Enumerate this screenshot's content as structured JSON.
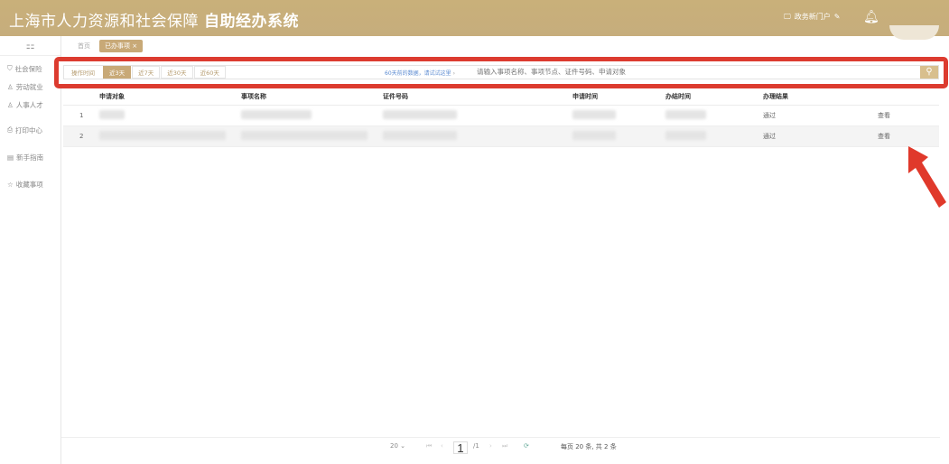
{
  "header": {
    "title": "上海市人力资源和社会保障",
    "subtitle": "自助经办系统",
    "portal_label": "政务新门户",
    "portal_icon": "monitor-icon",
    "bell_icon": "bell-icon"
  },
  "sidebar": {
    "items": [
      {
        "label": "社会保险",
        "icon": "shield-icon"
      },
      {
        "label": "劳动就业",
        "icon": "person-icon"
      },
      {
        "label": "人事人才",
        "icon": "user-icon"
      },
      {
        "label": "打印中心",
        "icon": "printer-icon"
      },
      {
        "label": "新手指南",
        "icon": "guide-icon"
      },
      {
        "label": "收藏事项",
        "icon": "star-icon"
      }
    ]
  },
  "tabs": [
    {
      "label": "首页"
    },
    {
      "label": "已办事项",
      "close": "×"
    }
  ],
  "filter": {
    "label": "操作时间",
    "options": [
      "近3天",
      "近7天",
      "近30天",
      "近60天"
    ],
    "active": "近3天",
    "hint": "60天前的数据，请试试这里",
    "hint_chevron": "›",
    "search_placeholder": "请输入事项名称、事项节点、证件号码、申请对象"
  },
  "table": {
    "columns": [
      "申请对象",
      "事项名称",
      "证件号码",
      "申请时间",
      "办结时间",
      "办理结果",
      ""
    ],
    "rows": [
      {
        "index": "1",
        "result": "通过",
        "action": "查看"
      },
      {
        "index": "2",
        "result": "通过",
        "action": "查看"
      }
    ]
  },
  "pager": {
    "page_size": "20",
    "current_page": "1",
    "total_pages": "/1",
    "summary": "每页 20 条, 共 2 条"
  },
  "colors": {
    "brand": "#c8a977",
    "highlight": "#dc3b2f"
  }
}
